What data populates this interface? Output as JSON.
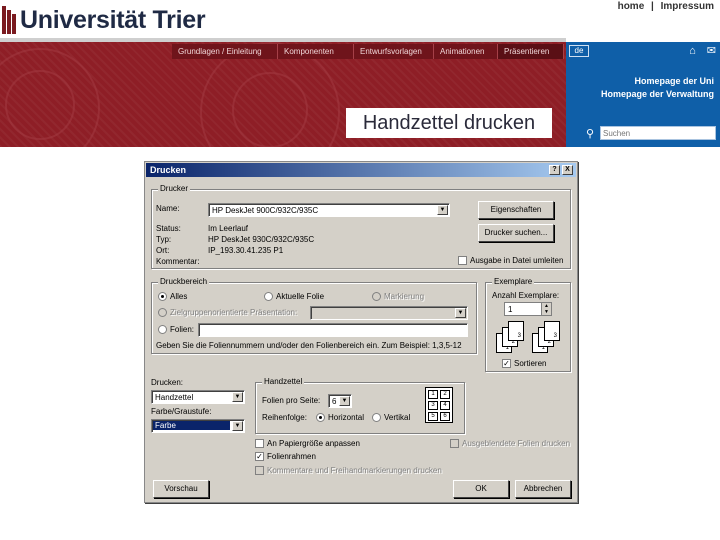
{
  "header": {
    "university_name": "Universität Trier",
    "top_links": [
      "home",
      "|",
      "Impressum"
    ],
    "nav_items": [
      "Grundlagen / Einleitung",
      "Komponenten",
      "Entwurfsvorlagen",
      "Animationen",
      "Präsentieren"
    ],
    "page_title": "Handzettel drucken",
    "lang": "de",
    "panel_links": [
      "Homepage der Uni",
      "Homepage der Verwaltung"
    ],
    "search_placeholder": "Suchen",
    "colors": {
      "brand_red": "#8e1e26",
      "panel_blue": "#0f5fa8"
    }
  },
  "dialog": {
    "title": "Drucken",
    "titlebar_buttons": [
      "?",
      "X"
    ],
    "printer": {
      "group_label": "Drucker",
      "name_label": "Name:",
      "name_value": "HP DeskJet 900C/932C/935C",
      "properties_button": "Eigenschaften",
      "status_label": "Status:",
      "status_value": "Im Leerlauf",
      "type_label": "Typ:",
      "type_value": "HP DeskJet 930C/932C/935C",
      "location_label": "Ort:",
      "location_value": "IP_193.30.41.235 P1",
      "comment_label": "Kommentar:",
      "find_printer_button": "Drucker suchen...",
      "print_to_file_label": "Ausgabe in Datei umleiten"
    },
    "range": {
      "group_label": "Druckbereich",
      "all_label": "Alles",
      "current_slide_label": "Aktuelle Folie",
      "selection_label": "Markierung",
      "custom_show_label": "Zielgruppenorientierte Präsentation:",
      "slides_label": "Folien:",
      "hint": "Geben Sie die Foliennummern und/oder den Folienbereich ein. Zum Beispiel: 1,3,5-12"
    },
    "copies": {
      "group_label": "Exemplare",
      "count_label": "Anzahl Exemplare:",
      "count_value": "1",
      "collate_label": "Sortieren",
      "page_numbers": [
        "1",
        "2",
        "3",
        "1",
        "2",
        "3"
      ]
    },
    "print_what": {
      "label": "Drucken:",
      "value": "Handzettel",
      "color_label": "Farbe/Graustufe:",
      "color_value": "Farbe"
    },
    "handouts": {
      "group_label": "Handzettel",
      "per_page_label": "Folien pro Seite:",
      "per_page_value": "6",
      "order_label": "Reihenfolge:",
      "horizontal_label": "Horizontal",
      "vertical_label": "Vertikal",
      "grid_numbers": [
        "1",
        "2",
        "3",
        "4",
        "5",
        "6"
      ]
    },
    "options": {
      "scale_label": "An Papiergröße anpassen",
      "frame_label": "Folienrahmen",
      "comments_label": "Kommentare und Freihandmarkierungen drucken",
      "hidden_label": "Ausgeblendete Folien drucken"
    },
    "buttons": {
      "preview": "Vorschau",
      "ok": "OK",
      "cancel": "Abbrechen"
    }
  }
}
